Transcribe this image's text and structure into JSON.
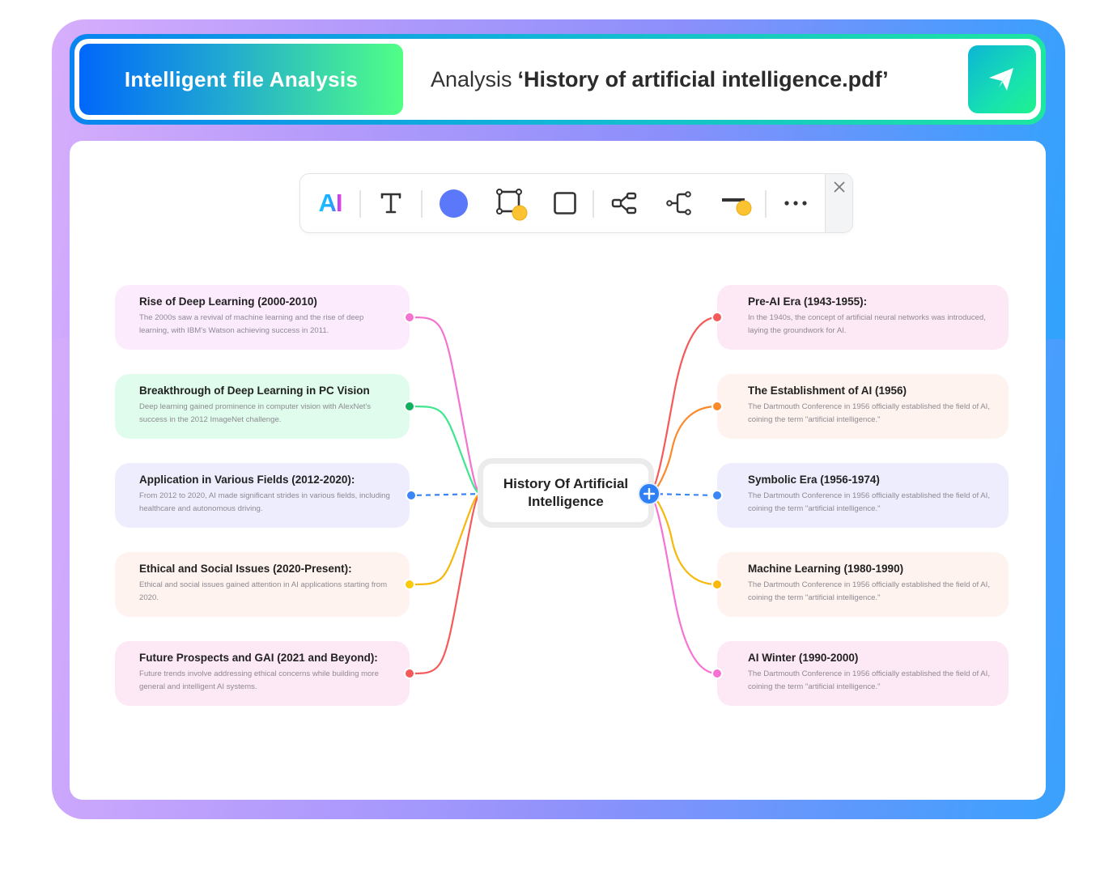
{
  "header": {
    "badge_label": "Intelligent file Analysis",
    "title_prefix": "Analysis",
    "file_name": "‘History of artificial intelligence.pdf’",
    "send_icon": "paper-plane-icon"
  },
  "toolbar": {
    "tools": [
      {
        "name": "ai-tool",
        "label": "AI",
        "icon": "ai-text-icon"
      },
      {
        "name": "text-tool",
        "icon": "text-T-icon"
      },
      {
        "name": "fill-color-tool",
        "icon": "color-circle-icon",
        "color": "#5a78f9"
      },
      {
        "name": "border-color-tool",
        "icon": "border-corners-icon",
        "badge_color": "#fbc231"
      },
      {
        "name": "shape-tool",
        "icon": "square-icon"
      },
      {
        "name": "layout-tool",
        "icon": "mindmap-structure-icon"
      },
      {
        "name": "branch-tool",
        "icon": "branch-connector-icon"
      },
      {
        "name": "line-style-tool",
        "icon": "line-weight-icon",
        "badge_color": "#fbc231"
      },
      {
        "name": "more-tool",
        "icon": "more-dots-icon"
      }
    ],
    "close_icon": "close-icon"
  },
  "mindmap": {
    "central_topic": "History Of Artificial Intelligence",
    "add_icon": "plus-icon",
    "left_nodes": [
      {
        "title": "Rise of Deep Learning (2000-2010)",
        "description": "The 2000s saw a revival of machine learning and the rise of deep learning, with IBM's Watson achieving success in 2011.",
        "bg": "#fcebfd",
        "color": "#f472d0"
      },
      {
        "title": "Breakthrough of Deep Learning in PC Vision",
        "description": "Deep learning gained prominence in computer vision with AlexNet's success in the 2012 ImageNet challenge.",
        "bg": "#dffcec",
        "color": "#10b05c",
        "line_color": "#3ee68e"
      },
      {
        "title": "Application in Various Fields (2012-2020):",
        "description": "From 2012 to 2020, AI made significant strides in various fields, including healthcare and autonomous driving.",
        "bg": "#eeedfd",
        "color": "#3a86f6",
        "dashed": true
      },
      {
        "title": "Ethical and Social Issues  (2020-Present):",
        "description": "Ethical and social issues gained attention in AI applications starting from 2020.",
        "bg": "#fef3ee",
        "color": "#fbcb0a",
        "line_color": "#f6b80c"
      },
      {
        "title": "Future Prospects and GAI (2021 and Beyond):",
        "description": "Future trends involve addressing ethical concerns while building more general and intelligent AI systems.",
        "bg": "#fde9f5",
        "color": "#f55a5a"
      }
    ],
    "right_nodes": [
      {
        "title": "Pre-AI Era (1943-1955):",
        "description": "In the 1940s, the concept of artificial neural networks was introduced, laying the groundwork for AI.",
        "bg": "#fde9f5",
        "color": "#f55a5a"
      },
      {
        "title": "The Establishment of AI (1956)",
        "description": "The Dartmouth Conference in 1956 officially established the field of AI, coining the term \"artificial intelligence.\"",
        "bg": "#fef3ee",
        "color": "#fb8a2c"
      },
      {
        "title": "Symbolic Era (1956-1974)",
        "description": "The Dartmouth Conference in 1956 officially established the field of AI, coining the term \"artificial intelligence.\"",
        "bg": "#eeedfd",
        "color": "#3a86f6",
        "dashed": true
      },
      {
        "title": "Machine Learning (1980-1990)",
        "description": "The Dartmouth Conference in 1956 officially established the field of AI, coining the term \"artificial intelligence.\"",
        "bg": "#fef3ee",
        "color": "#fbb70a",
        "line_color": "#f6b80c"
      },
      {
        "title": "AI Winter (1990-2000)",
        "description": "The Dartmouth Conference in 1956 officially established the field of AI, coining the term \"artificial intelligence.\"",
        "bg": "#fde9f5",
        "color": "#f772d4"
      }
    ]
  }
}
